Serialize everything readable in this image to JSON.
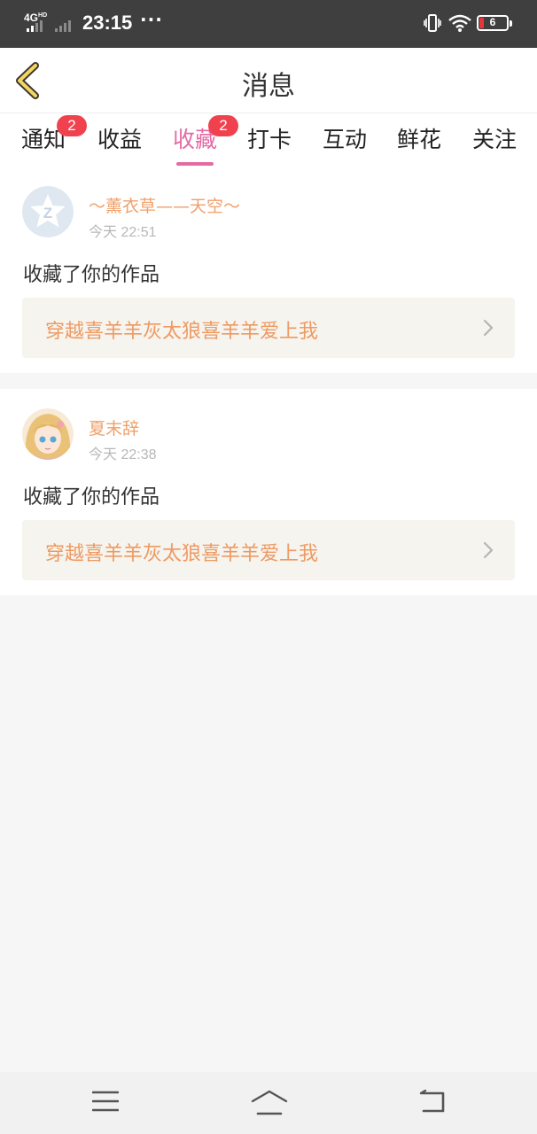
{
  "status_bar": {
    "network": "4G",
    "network_hd": "HD",
    "time": "23:15",
    "more": "···",
    "battery_level": "6",
    "battery_color": "#e8353a"
  },
  "nav": {
    "title": "消息",
    "back_icon": "chevron-left-icon"
  },
  "tabs": [
    {
      "label": "通知",
      "badge": "2"
    },
    {
      "label": "收益"
    },
    {
      "label": "收藏",
      "badge": "2",
      "active": true
    },
    {
      "label": "打卡"
    },
    {
      "label": "互动"
    },
    {
      "label": "鲜花"
    },
    {
      "label": "关注"
    }
  ],
  "colors": {
    "accent": "#e46aa4",
    "badge": "#f0414e",
    "username": "#f0a06a",
    "work_title": "#ee9a63"
  },
  "notifications": [
    {
      "username": "～薰衣草——天空～",
      "time": "今天 22:51",
      "message": "收藏了你的作品",
      "work_title": "穿越喜羊羊灰太狼喜羊羊爱上我",
      "avatar": "qq-default-avatar"
    },
    {
      "username": "夏末辞",
      "time": "今天 22:38",
      "message": "收藏了你的作品",
      "work_title": "穿越喜羊羊灰太狼喜羊羊爱上我",
      "avatar": "anime-girl-avatar"
    }
  ],
  "system_nav": [
    "menu-icon",
    "home-icon",
    "back-icon"
  ]
}
